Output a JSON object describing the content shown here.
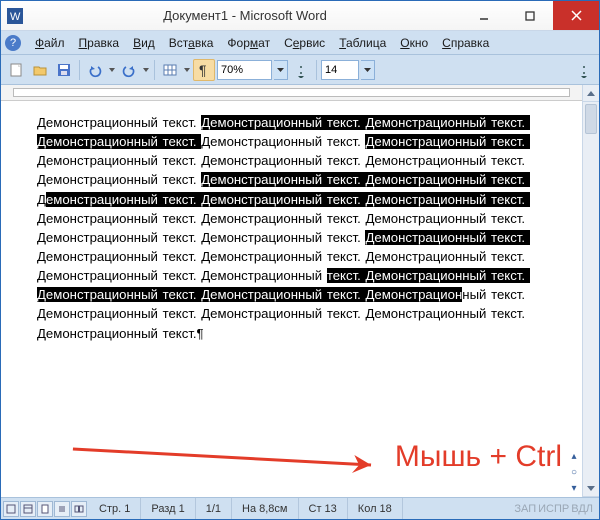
{
  "title": "Документ1 - Microsoft Word",
  "menu": {
    "file": "Файл",
    "edit": "Правка",
    "view": "Вид",
    "insert": "Вставка",
    "format": "Формат",
    "service": "Сервис",
    "table": "Таблица",
    "window": "Окно",
    "help": "Справка"
  },
  "toolbar": {
    "zoom": "70%",
    "font_size": "14"
  },
  "doc": {
    "segments": [
      {
        "t": "Демонстрационный текст. ",
        "hl": false
      },
      {
        "t": "Демонстрационный текст. ",
        "hl": true
      },
      {
        "t": "Демонстрационный ",
        "hl": true
      },
      {
        "t": "текст. ",
        "hl": true
      },
      {
        "t": "Демонстрационный текст. ",
        "hl": true
      },
      {
        "t": "Демонстрационный текст. ",
        "hl": false
      },
      {
        "t": "Демонстрационный текст. ",
        "hl": true
      },
      {
        "t": "Д",
        "hl": false
      },
      {
        "t": "емонстрационный текст. ",
        "hl": false
      },
      {
        "t": "Демонстрационный текст. ",
        "hl": false
      },
      {
        "t": "Демонстрационный текст. ",
        "hl": false
      },
      {
        "t": "Демонстрационный текст. ",
        "hl": false
      },
      {
        "t": "Демонстрационный текст. ",
        "hl": true
      },
      {
        "t": "Демонстрационный текст. ",
        "hl": true
      },
      {
        "t": "Д",
        "hl": false
      },
      {
        "t": "емонстрационный текст. ",
        "hl": true
      },
      {
        "t": "Демонстрационный текст. ",
        "hl": true
      },
      {
        "t": "Демонстрационный текст. ",
        "hl": true
      },
      {
        "t": "Д",
        "hl": false
      },
      {
        "t": "емонстрационный текст. ",
        "hl": false
      },
      {
        "t": "Демонстрационный текст. ",
        "hl": false
      },
      {
        "t": "Демонстрационный текст. ",
        "hl": false
      },
      {
        "t": "Демонстрационный текст. ",
        "hl": false
      },
      {
        "t": "Демонстрационный текст. ",
        "hl": false
      },
      {
        "t": "Демонстрационный текст. ",
        "hl": true
      },
      {
        "t": "Демонстрационный текст. ",
        "hl": false
      },
      {
        "t": "Демонстрационный текст. ",
        "hl": false
      },
      {
        "t": "Демонстрационный текст. ",
        "hl": false
      },
      {
        "t": "Демонстрационный текст. ",
        "hl": false
      },
      {
        "t": "Демонстрационный ",
        "hl": false
      },
      {
        "t": "текст. ",
        "hl": true
      },
      {
        "t": "Демонстрационный текст. ",
        "hl": true
      },
      {
        "t": "Демонстрационный ",
        "hl": true
      },
      {
        "t": "текст. ",
        "hl": true
      },
      {
        "t": "Демонстрационный текст. ",
        "hl": true
      },
      {
        "t": "Демонстрацион",
        "hl": true
      },
      {
        "t": "ный текст. ",
        "hl": false
      },
      {
        "t": "Демонстрационный текст. ",
        "hl": false
      },
      {
        "t": "Демонстрационный текст. ",
        "hl": false
      },
      {
        "t": "Демонстрационный текст. ",
        "hl": false
      },
      {
        "t": "Демонстрационный текст.¶",
        "hl": false
      }
    ]
  },
  "annotation": "Мышь + Ctrl",
  "status": {
    "page": "Стр. 1",
    "section": "Разд 1",
    "pages": "1/1",
    "pos": "На 8,8см",
    "line": "Ст 13",
    "col": "Кол 18",
    "rec": "ЗАП",
    "trk": "ИСПР",
    "ext": "ВДЛ"
  }
}
